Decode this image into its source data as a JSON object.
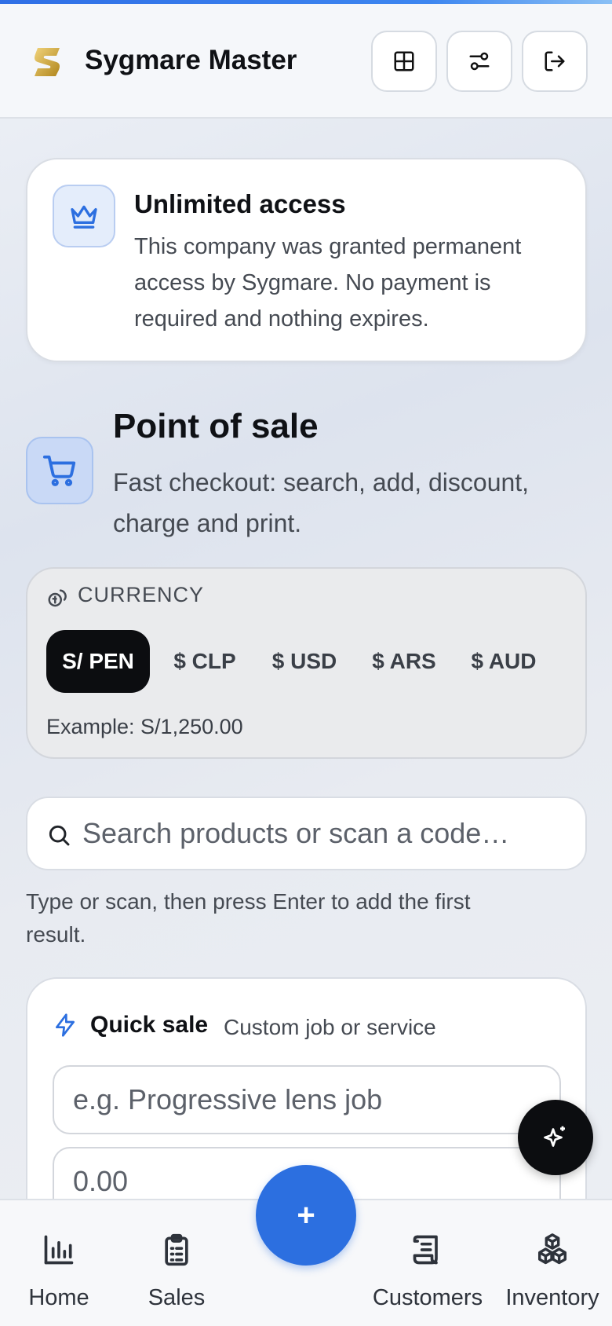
{
  "app": {
    "title": "Sygmare Master"
  },
  "header": {
    "buttons": [
      {
        "icon": "grid-icon"
      },
      {
        "icon": "sliders-icon"
      },
      {
        "icon": "logout-icon"
      }
    ]
  },
  "access": {
    "icon": "crown-icon",
    "title": "Unlimited access",
    "text": "This company was granted permanent access by Sygmare. No payment is required and nothing expires."
  },
  "pos": {
    "icon": "cart-icon",
    "title": "Point of sale",
    "subtitle": "Fast checkout: search, add, discount, charge and print."
  },
  "currency": {
    "label": "CURRENCY",
    "options": [
      "S/ PEN",
      "$ CLP",
      "$ USD",
      "$ ARS",
      "$ AUD"
    ],
    "selected": "S/ PEN",
    "example": "Example: S/1,250.00"
  },
  "search": {
    "placeholder": "Search products or scan a code…",
    "hint": "Type or scan, then press Enter to add the first result."
  },
  "quick_sale": {
    "title": "Quick sale",
    "subtitle": "Custom job or service",
    "description_placeholder": "e.g. Progressive lens job",
    "amount_placeholder": "0.00"
  },
  "fab": {
    "ai_icon": "sparkles-icon",
    "add_label": "+"
  },
  "nav": {
    "items": [
      {
        "label": "Home",
        "icon": "chart-icon"
      },
      {
        "label": "Sales",
        "icon": "clipboard-icon"
      },
      {
        "label": "Customers",
        "icon": "scroll-icon"
      },
      {
        "label": "Inventory",
        "icon": "boxes-icon"
      }
    ]
  },
  "colors": {
    "accent": "#2c6fe0",
    "dark": "#0c0d10",
    "gold": "#c9a227"
  }
}
